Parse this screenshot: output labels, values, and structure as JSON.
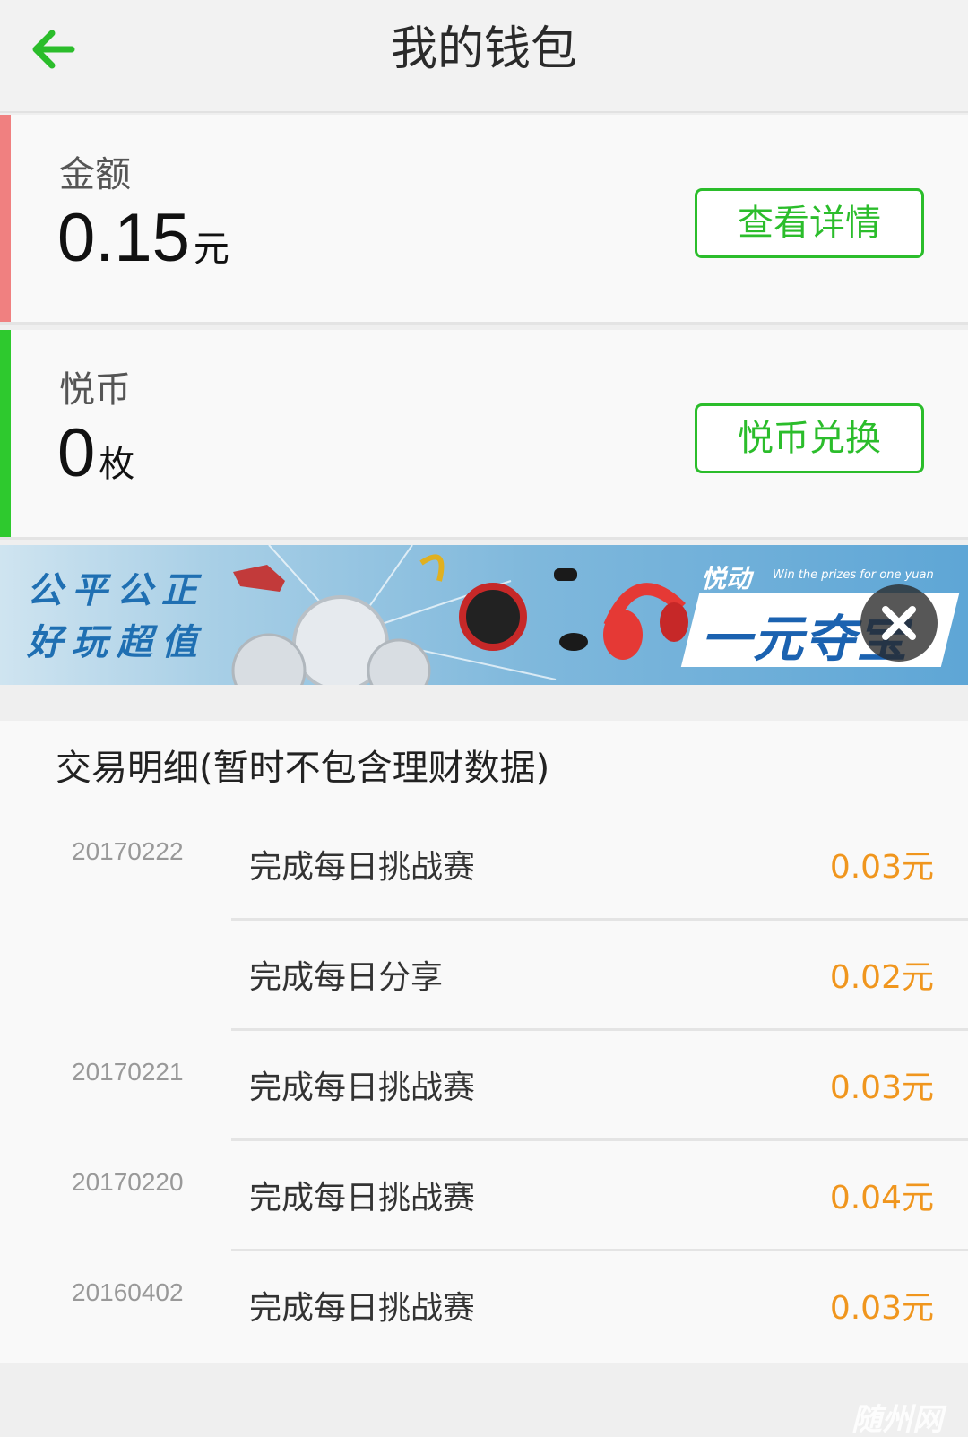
{
  "header": {
    "title": "我的钱包"
  },
  "amount_card": {
    "label": "金额",
    "value": "0.15",
    "unit": "元",
    "button": "查看详情",
    "accent_color": "#f08080"
  },
  "coin_card": {
    "label": "悦币",
    "value": "0",
    "unit": "枚",
    "button": "悦币兑换",
    "accent_color": "#2ec92e"
  },
  "banner": {
    "slogan_line1": "公平公正",
    "slogan_line2": "好玩超值",
    "brand": "悦动",
    "tagline": "Win the prizes for one yuan",
    "headline": "一元夺宝"
  },
  "transactions": {
    "title": "交易明细(暂时不包含理财数据)",
    "rows": [
      {
        "date": "20170222",
        "desc": "完成每日挑战赛",
        "amount": "0.03元"
      },
      {
        "date": "",
        "desc": "完成每日分享",
        "amount": "0.02元"
      },
      {
        "date": "20170221",
        "desc": "完成每日挑战赛",
        "amount": "0.03元"
      },
      {
        "date": "20170220",
        "desc": "完成每日挑战赛",
        "amount": "0.04元"
      },
      {
        "date": "20160402",
        "desc": "完成每日挑战赛",
        "amount": "0.03元"
      }
    ]
  },
  "watermark": "随州网",
  "colors": {
    "primary_green": "#2bbd2b",
    "amount_orange": "#f0961e"
  }
}
